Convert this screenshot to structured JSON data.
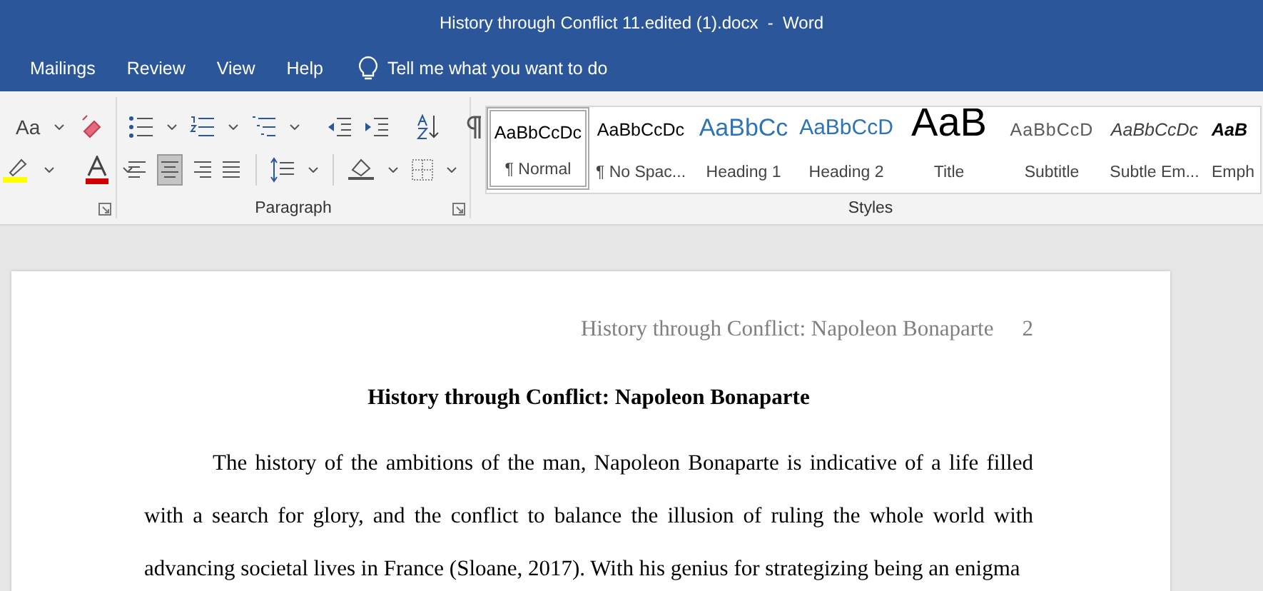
{
  "window": {
    "title": "History through Conflict 11.edited (1).docx  -  Word"
  },
  "ribbon_tabs": [
    {
      "label": "Mailings",
      "selected": false
    },
    {
      "label": "Review",
      "selected": false
    },
    {
      "label": "View",
      "selected": false
    },
    {
      "label": "Help",
      "selected": false
    }
  ],
  "tell_me": {
    "placeholder": "Tell me what you want to do"
  },
  "font_group": {
    "change_case": "Aa"
  },
  "paragraph_group": {
    "label": "Paragraph",
    "alignments": [
      {
        "kind": "left",
        "selected": false
      },
      {
        "kind": "center",
        "selected": true
      },
      {
        "kind": "right",
        "selected": false
      },
      {
        "kind": "justify",
        "selected": false
      }
    ]
  },
  "styles_group": {
    "label": "Styles",
    "styles": [
      {
        "kind": "normal",
        "sample": "AaBbCcDc",
        "name": "¶ Normal",
        "selected": true
      },
      {
        "kind": "normal",
        "sample": "AaBbCcDc",
        "name": "¶ No Spac...",
        "selected": false
      },
      {
        "kind": "heading1",
        "sample": "AaBbCc",
        "name": "Heading 1",
        "selected": false
      },
      {
        "kind": "heading2",
        "sample": "AaBbCcD",
        "name": "Heading 2",
        "selected": false
      },
      {
        "kind": "title",
        "sample": "AaB",
        "name": "Title",
        "selected": false
      },
      {
        "kind": "subtitle",
        "sample": "AaBbCcD",
        "name": "Subtitle",
        "selected": false
      },
      {
        "kind": "subtle",
        "sample": "AaBbCcDc",
        "name": "Subtle Em...",
        "selected": false
      },
      {
        "kind": "emphasis",
        "sample": "AaB",
        "name": "Emph",
        "selected": false
      }
    ]
  },
  "document": {
    "header": "History through Conflict: Napoleon Bonaparte",
    "page_number": "2",
    "heading": "History through Conflict: Napoleon Bonaparte",
    "paragraph": "The history of the ambitions of the man, Napoleon Bonaparte is indicative of a life filled with a search for glory, and the conflict to balance the illusion of ruling the whole world with advancing societal lives in France (Sloane, 2017). With his genius for strategizing being an enigma"
  }
}
